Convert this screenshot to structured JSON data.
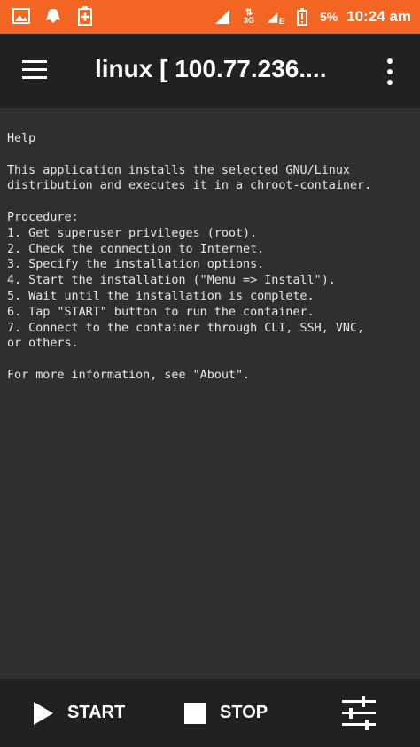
{
  "status_bar": {
    "battery_percent": "5%",
    "time": "10:24 am",
    "network_3g": "3G",
    "network_e": "E",
    "accent_color": "#f26522"
  },
  "app_bar": {
    "title": "linux  [ 100.77.236....",
    "menu_icon": "hamburger-menu-icon",
    "overflow_icon": "more-vert-icon"
  },
  "help": {
    "text": "Help\n\nThis application installs the selected GNU/Linux\ndistribution and executes it in a chroot-container.\n\nProcedure:\n1. Get superuser privileges (root).\n2. Check the connection to Internet.\n3. Specify the installation options.\n4. Start the installation (\"Menu => Install\").\n5. Wait until the installation is complete.\n6. Tap \"START\" button to run the container.\n7. Connect to the container through CLI, SSH, VNC,\nor others.\n\nFor more information, see \"About\"."
  },
  "bottom_bar": {
    "start_label": "START",
    "stop_label": "STOP",
    "settings_icon": "sliders-icon"
  }
}
